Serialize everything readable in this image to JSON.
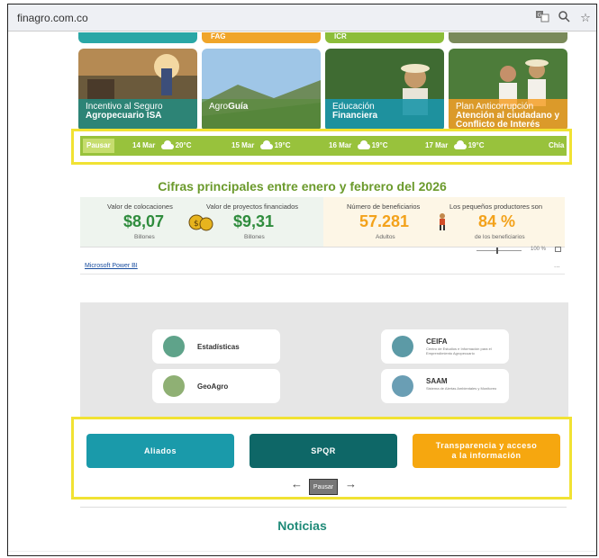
{
  "browser": {
    "url": "finagro.com.co"
  },
  "tiles_top": [
    "FAG",
    "ICR"
  ],
  "tiles": [
    {
      "title": "Incentivo al Seguro",
      "bold": "Agropecuario ISA"
    },
    {
      "title": "Agro",
      "bold": "Guía"
    },
    {
      "title": "Educación",
      "bold": "Financiera"
    },
    {
      "title": "Plan Anticorrupción",
      "bold": "Atención al ciudadano y Conflicto de Interés"
    }
  ],
  "ticker": {
    "pause_label": "Pausar",
    "items": [
      {
        "date": "14 Mar",
        "temp": "20°C"
      },
      {
        "date": "15 Mar",
        "temp": "19°C"
      },
      {
        "date": "16 Mar",
        "temp": "19°C"
      },
      {
        "date": "17 Mar",
        "temp": "19°C"
      }
    ],
    "city": "Chía"
  },
  "stats": {
    "title": "Cifras principales entre enero y febrero del 2026",
    "colocaciones": {
      "label": "Valor de colocaciones",
      "value": "$8,07",
      "unit": "Billones"
    },
    "proyectos": {
      "label": "Valor de proyectos financiados",
      "value": "$9,31",
      "unit": "Billones"
    },
    "beneficiarios": {
      "label": "Número de beneficiarios",
      "value": "57.281",
      "unit": "Adultos"
    },
    "productores": {
      "label": "Los pequeños productores son",
      "value": "84 %",
      "unit": "de los beneficiarios"
    },
    "zoom": "100 %",
    "powerbi_link": "Microsoft Power BI",
    "more": "..."
  },
  "cards": [
    {
      "title": "Estadísticas",
      "subtitle": ""
    },
    {
      "title": "GeoAgro",
      "subtitle": ""
    },
    {
      "title": "CEIFA",
      "subtitle": "Centro de Estudios e Información para el Emprendimiento Agropecuario"
    },
    {
      "title": "SAAM",
      "subtitle": "Sistema de Alertas Ambientales y Monitoreo"
    }
  ],
  "buttons": {
    "aliados": "Aliados",
    "spqr": "SPQR",
    "transparencia": "Transparencia y acceso a la información",
    "pause": "Pausar"
  },
  "news": "Noticias",
  "colors": {
    "ticker": "#98c23c",
    "title_green": "#6b9a2c",
    "value_green": "#2f8c3d",
    "value_orange": "#f3a21b",
    "aliados": "#1a9aaa",
    "spqr": "#0e6767",
    "transparencia": "#f6a70f",
    "highlight": "#f1e233"
  }
}
